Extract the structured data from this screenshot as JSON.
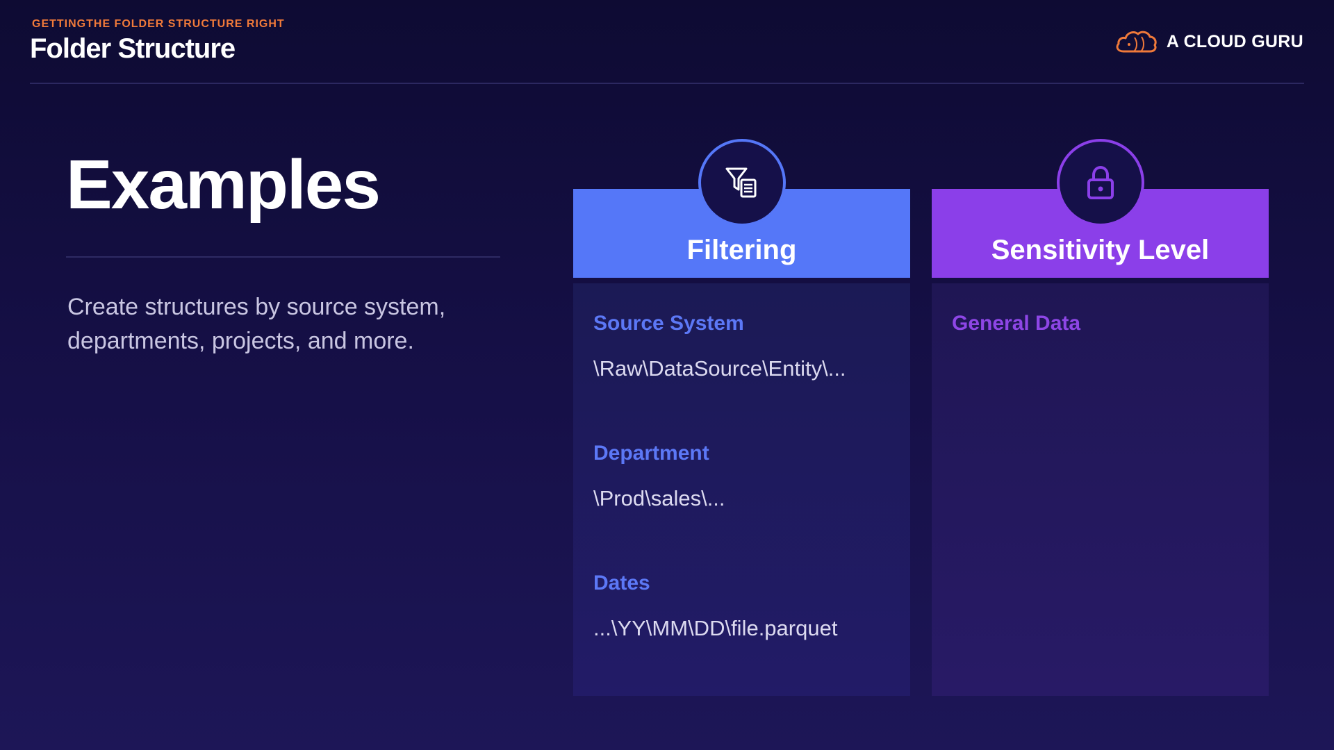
{
  "header": {
    "eyebrow": "GETTINGTHE FOLDER STRUCTURE RIGHT",
    "title": "Folder Structure"
  },
  "brand": {
    "name": "A CLOUD GURU",
    "icon": "cloud-logo-icon",
    "accent_color": "#f07a3a"
  },
  "main": {
    "heading": "Examples",
    "description": "Create structures by source system, departments, projects, and more."
  },
  "cards": [
    {
      "title": "Filtering",
      "icon": "filter-document-icon",
      "color": "#5577f8",
      "items": [
        {
          "label": "Source System",
          "path": "\\Raw\\DataSource\\Entity\\..."
        },
        {
          "label": "Department",
          "path": "\\Prod\\sales\\..."
        },
        {
          "label": "Dates",
          "path": "...\\YY\\MM\\DD\\file.parquet"
        }
      ]
    },
    {
      "title": "Sensitivity Level",
      "icon": "lock-icon",
      "color": "#8b3fe9",
      "items": [
        {
          "label": "General Data"
        }
      ]
    }
  ]
}
